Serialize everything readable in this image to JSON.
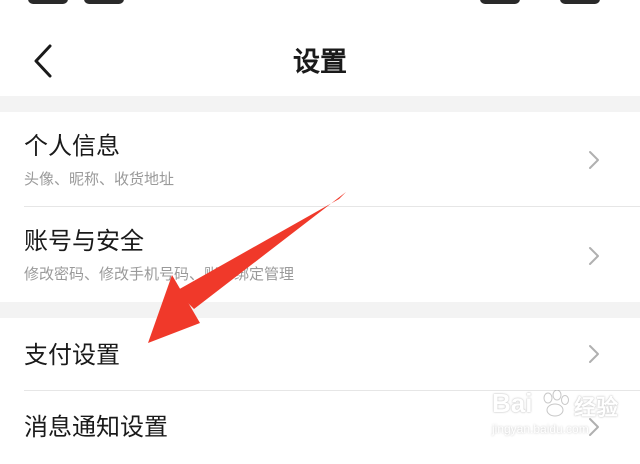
{
  "header": {
    "title": "设置",
    "back_icon": "chevron-left-icon"
  },
  "groups": [
    {
      "items": [
        {
          "title": "个人信息",
          "subtitle": "头像、昵称、收货地址"
        },
        {
          "title": "账号与安全",
          "subtitle": "修改密码、修改手机号码、账号绑定管理"
        }
      ]
    },
    {
      "items": [
        {
          "title": "支付设置"
        },
        {
          "title": "消息通知设置"
        }
      ]
    }
  ],
  "annotation": {
    "arrow_color": "#f0392a",
    "points_to": "支付设置"
  },
  "watermark": {
    "brand": "Bai",
    "suffix": "经验",
    "url": "jingyan.baidu.com"
  },
  "colors": {
    "background": "#f3f3f3",
    "card": "#ffffff",
    "text_primary": "#1a1a1a",
    "text_secondary": "#9a9a9a",
    "divider": "#e6e6e6",
    "arrow": "#f0392a"
  }
}
